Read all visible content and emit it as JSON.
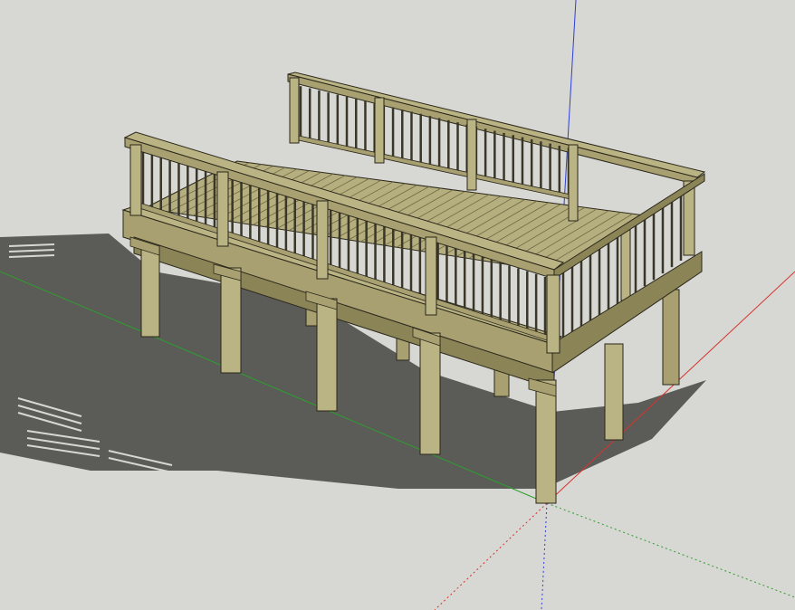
{
  "viewport": {
    "background": "#d7d7d3",
    "model": "elevated-deck-with-railing",
    "view": "perspective",
    "shadows": true
  },
  "axes": {
    "x_color": "#d8322c",
    "y_color": "#2da02d",
    "z_color": "#2f3fd8"
  },
  "materials": {
    "wood_light": "#bab383",
    "wood_mid": "#a8a070",
    "wood_dark": "#8b8457",
    "edge": "#2a271b",
    "shadow": "#5b5b58",
    "baluster": "#3a3628"
  }
}
